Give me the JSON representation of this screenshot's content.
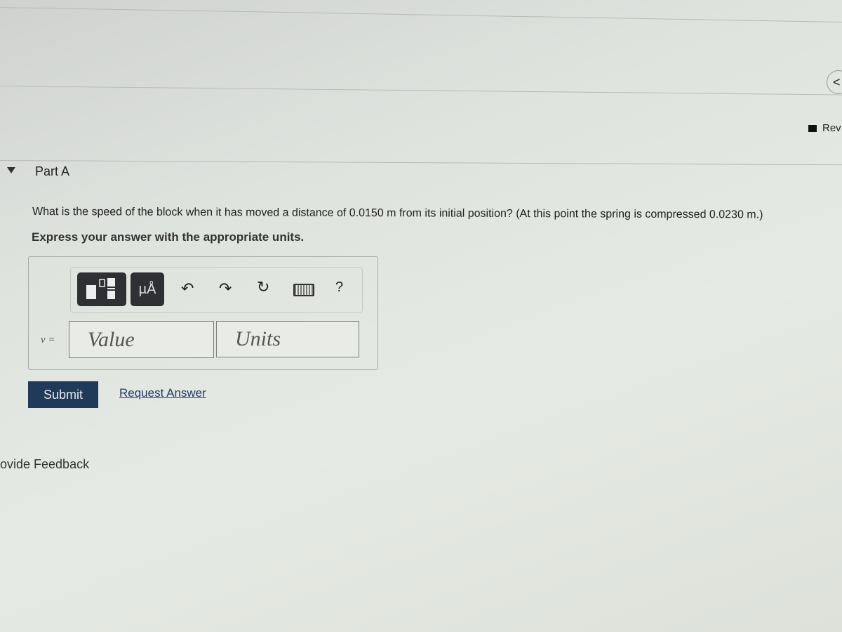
{
  "header": {
    "back_icon": "chevron-left-icon",
    "review_label": "Rev"
  },
  "part": {
    "title": "Part A",
    "toggle_icon": "triangle-down-icon"
  },
  "question": {
    "text": "What is the speed of the block when it has moved a distance of 0.0150 m from its initial position? (At this point the spring is compressed 0.0230 m.)",
    "instruction": "Express your answer with the appropriate units."
  },
  "toolbar": {
    "templates_icon": "templates-icon",
    "units_label": "µÅ",
    "undo_icon": "undo-icon",
    "redo_icon": "redo-icon",
    "reset_icon": "reset-icon",
    "keyboard_icon": "keyboard-icon",
    "help_label": "?"
  },
  "answer": {
    "variable_label": "v =",
    "value_placeholder": "Value",
    "units_placeholder": "Units"
  },
  "actions": {
    "submit_label": "Submit",
    "request_label": "Request Answer"
  },
  "footer": {
    "feedback_label": "ovide Feedback"
  }
}
